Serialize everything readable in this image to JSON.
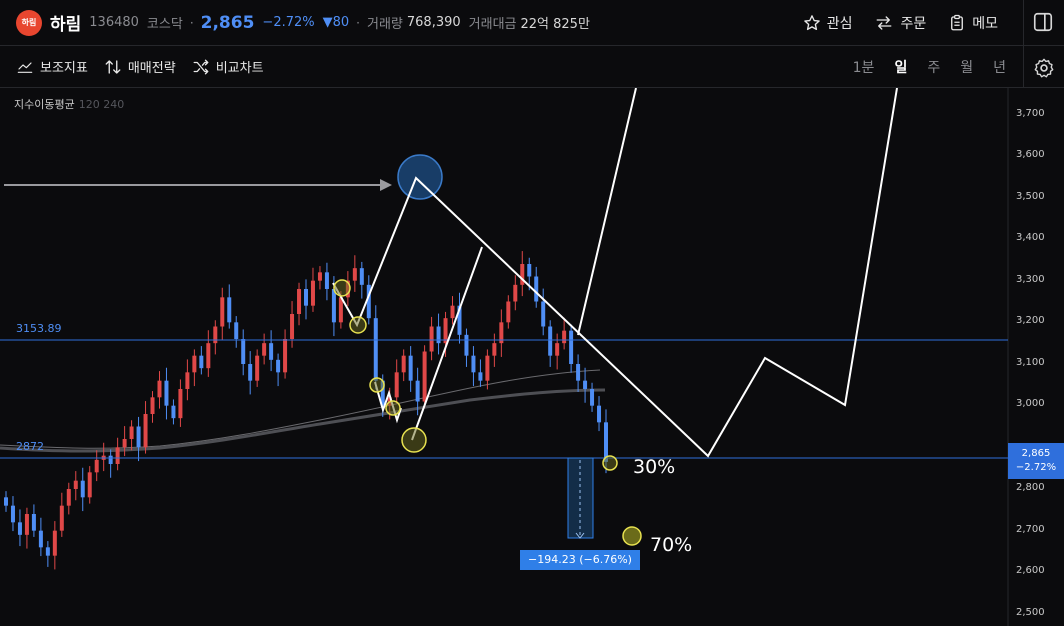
{
  "header": {
    "logo_text": "하림",
    "name": "하림",
    "code": "136480",
    "market": "코스닥",
    "price": "2,865",
    "change_pct": "−2.72%",
    "change_abs": "▼80",
    "volume_label": "거래량",
    "volume": "768,390",
    "amount_label": "거래대금",
    "amount": "22억 825만",
    "actions": {
      "watch": "관심",
      "order": "주문",
      "memo": "메모"
    }
  },
  "toolbar": {
    "indicators": "보조지표",
    "strategy": "매매전략",
    "compare": "비교차트",
    "periods": [
      "1분",
      "일",
      "주",
      "월",
      "년"
    ],
    "active_period": "일"
  },
  "chart": {
    "ma_label": "지수이동평균",
    "ma_periods": "120 240",
    "level_upper": "3153.89",
    "level_lower": "2872",
    "price_tag_value": "2,865",
    "price_tag_pct": "−2.72%",
    "measure_label": "−194.23 (−6.76%)",
    "note_30": "30%",
    "note_70": "70%",
    "y_ticks": [
      "3,700",
      "3,600",
      "3,500",
      "3,400",
      "3,300",
      "3,200",
      "3,100",
      "3,000",
      "2,800",
      "2,700",
      "2,600",
      "2,500"
    ],
    "colors": {
      "up": "#e04848",
      "down": "#4f8ef5",
      "level": "#2f6fdc"
    }
  },
  "chart_data": {
    "type": "candlestick",
    "y_axis_range": [
      2500,
      3750
    ],
    "horizontal_levels": [
      3153.89,
      2872
    ],
    "last_close": 2865,
    "closes": [
      2760,
      2720,
      2690,
      2740,
      2700,
      2660,
      2640,
      2700,
      2760,
      2800,
      2820,
      2780,
      2840,
      2870,
      2880,
      2860,
      2900,
      2920,
      2950,
      2900,
      2980,
      3020,
      3060,
      3000,
      2970,
      3040,
      3080,
      3120,
      3090,
      3150,
      3190,
      3260,
      3200,
      3160,
      3100,
      3060,
      3120,
      3150,
      3110,
      3080,
      3160,
      3220,
      3280,
      3240,
      3300,
      3320,
      3280,
      3200,
      3260,
      3300,
      3330,
      3290,
      3210,
      3060,
      3000,
      3020,
      3080,
      3120,
      3060,
      3010,
      3130,
      3190,
      3150,
      3210,
      3240,
      3170,
      3120,
      3080,
      3060,
      3120,
      3150,
      3200,
      3250,
      3290,
      3340,
      3310,
      3250,
      3190,
      3120,
      3150,
      3180,
      3100,
      3060,
      3040,
      3000,
      2960,
      2865
    ]
  }
}
